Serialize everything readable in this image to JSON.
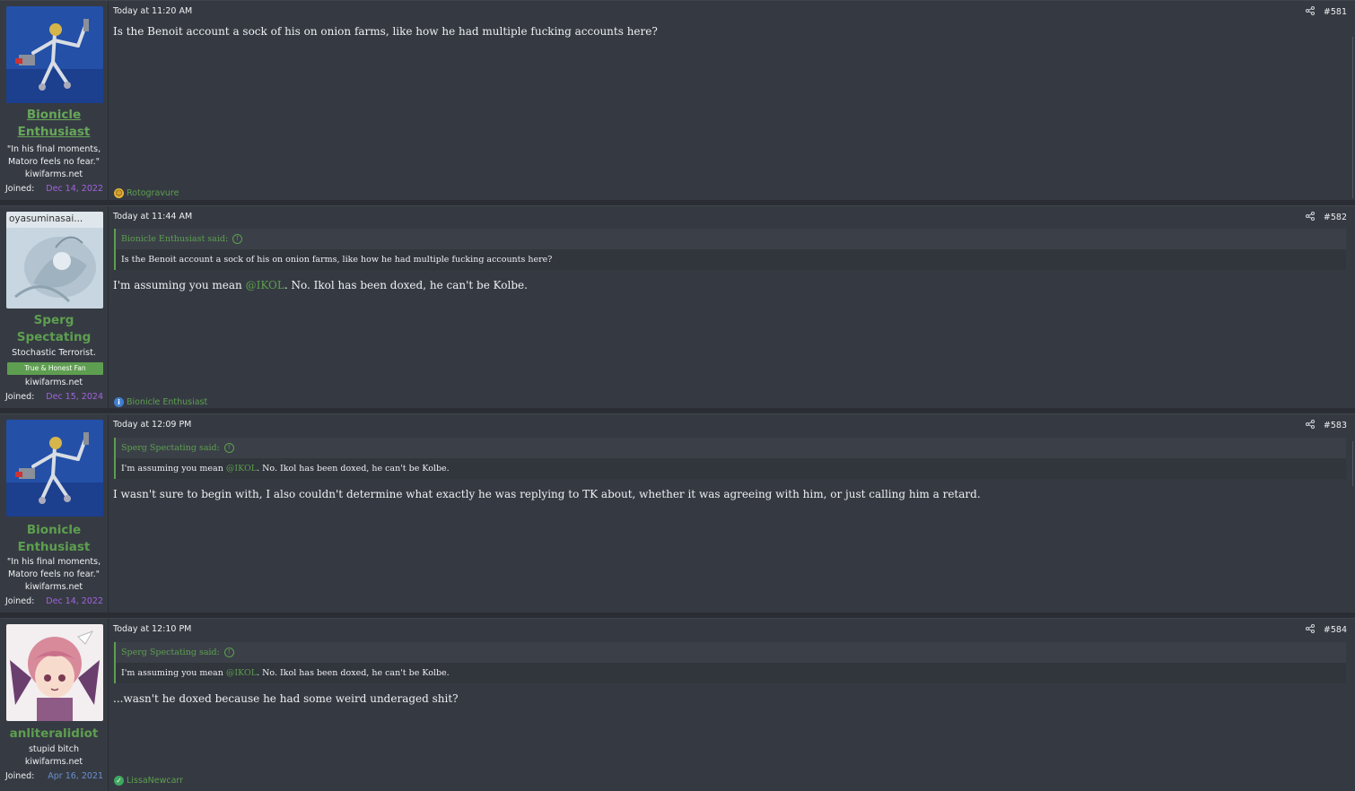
{
  "posts": [
    {
      "time": "Today at 11:20 AM",
      "number": "#581",
      "username": "Bionicle Enthusiast",
      "username_lines": [
        "Bionicle",
        "Enthusiast"
      ],
      "user_title_lines": [
        "\"In his final moments,",
        "Matoro feels no fear.\""
      ],
      "site": "kiwifarms.net",
      "joined_label": "Joined:",
      "joined_date": "Dec 14, 2022",
      "body": "Is the Benoit account a sock of his on onion farms, like how he had multiple fucking accounts here?",
      "reaction_user": "Rotogravure"
    },
    {
      "time": "Today at 11:44 AM",
      "number": "#582",
      "avatar_caption": "oyasuminasai...",
      "username": "Sperg Spectating",
      "username_lines": [
        "Sperg",
        "Spectating"
      ],
      "user_title_lines": [
        "Stochastic Terrorist."
      ],
      "banner": "True & Honest Fan",
      "site": "kiwifarms.net",
      "joined_label": "Joined:",
      "joined_date": "Dec 15, 2024",
      "quote_author": "Bionicle Enthusiast said:",
      "quote_text": "Is the Benoit account a sock of his on onion farms, like how he had multiple fucking accounts here?",
      "body_before": "I'm assuming you mean ",
      "body_mention": "@IKOL",
      "body_after": ". No. Ikol has been doxed, he can't be Kolbe.",
      "reaction_user": "Bionicle Enthusiast"
    },
    {
      "time": "Today at 12:09 PM",
      "number": "#583",
      "username": "Bionicle Enthusiast",
      "username_lines": [
        "Bionicle",
        "Enthusiast"
      ],
      "user_title_lines": [
        "\"In his final moments,",
        "Matoro feels no fear.\""
      ],
      "site": "kiwifarms.net",
      "joined_label": "Joined:",
      "joined_date": "Dec 14, 2022",
      "quote_author": "Sperg Spectating said:",
      "quote_before": "I'm assuming you mean ",
      "quote_mention": "@IKOL",
      "quote_after": ". No. Ikol has been doxed, he can't be Kolbe.",
      "body": "I wasn't sure to begin with, I also couldn't determine what exactly he was replying to TK about, whether it was agreeing with him, or just calling him a retard."
    },
    {
      "time": "Today at 12:10 PM",
      "number": "#584",
      "username": "anliteralidiot",
      "user_title_lines": [
        "stupid bitch"
      ],
      "site": "kiwifarms.net",
      "joined_label": "Joined:",
      "joined_date": "Apr 16, 2021",
      "quote_author": "Sperg Spectating said:",
      "quote_before": "I'm assuming you mean ",
      "quote_mention": "@IKOL",
      "quote_after": ". No. Ikol has been doxed, he can't be Kolbe.",
      "body": "...wasn't he doxed because he had some weird underaged shit?",
      "reaction_user": "LissaNewcarr"
    }
  ],
  "colors": {
    "accent_green": "#5d9f4f",
    "joined_purple": "#a262e0",
    "joined_blue": "#6a8fd0",
    "post_bg": "#353a42"
  }
}
